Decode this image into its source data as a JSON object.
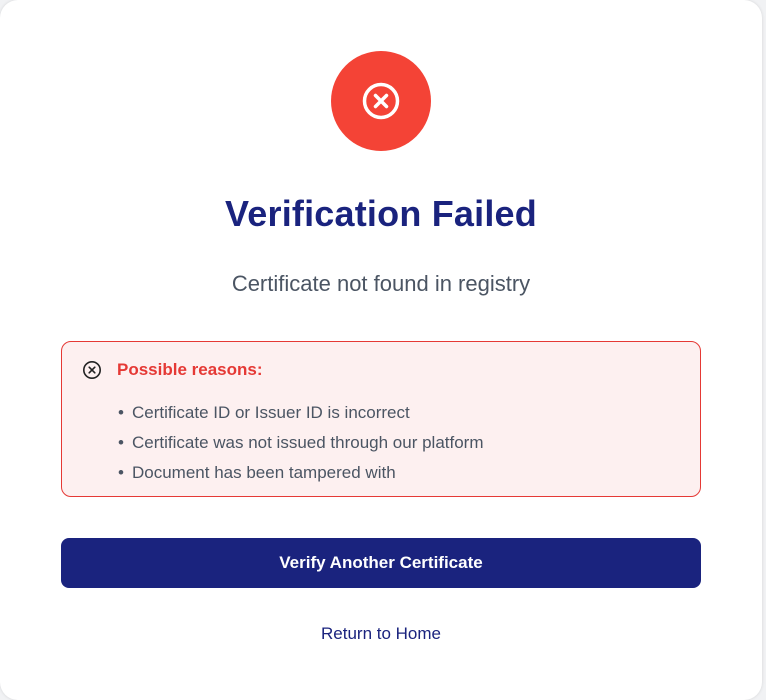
{
  "status": {
    "icon": "x-circle-icon",
    "color": "#f44336"
  },
  "title": "Verification Failed",
  "subtitle": "Certificate not found in registry",
  "reasons": {
    "icon": "x-circle-icon",
    "title": "Possible reasons:",
    "items": [
      "Certificate ID or Issuer ID is incorrect",
      "Certificate was not issued through our platform",
      "Document has been tampered with"
    ],
    "border_color": "#e53935",
    "background": "#fdf0f0"
  },
  "actions": {
    "primary_label": "Verify Another Certificate",
    "primary_color": "#1a237e",
    "home_label": "Return to Home"
  }
}
